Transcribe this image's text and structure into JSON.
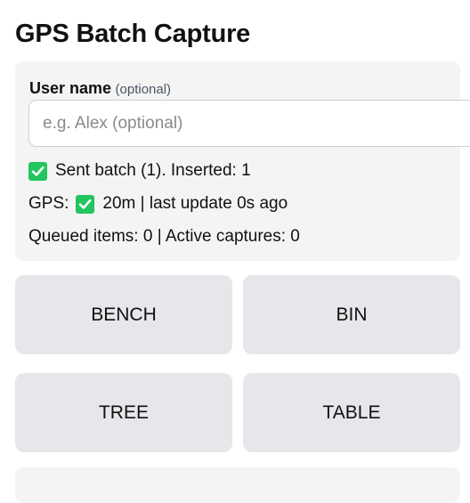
{
  "page": {
    "title": "GPS Batch Capture"
  },
  "user": {
    "label": "User name",
    "hint": "(optional)",
    "input_value": "",
    "placeholder": "e.g. Alex (optional)"
  },
  "status": {
    "batch_message": "Sent batch (1). Inserted: 1",
    "gps_prefix": "GPS:",
    "gps_detail": "20m | last update 0s ago",
    "queue_message": "Queued items: 0 | Active captures: 0",
    "check_icon": "check-mark-icon",
    "check_color": "#22c55e"
  },
  "capture_buttons": [
    {
      "label": "BENCH"
    },
    {
      "label": "BIN"
    },
    {
      "label": "TREE"
    },
    {
      "label": "TABLE"
    }
  ],
  "colors": {
    "panel_background": "#f4f4f5",
    "button_background": "#e7e7eb",
    "text": "#111111"
  }
}
